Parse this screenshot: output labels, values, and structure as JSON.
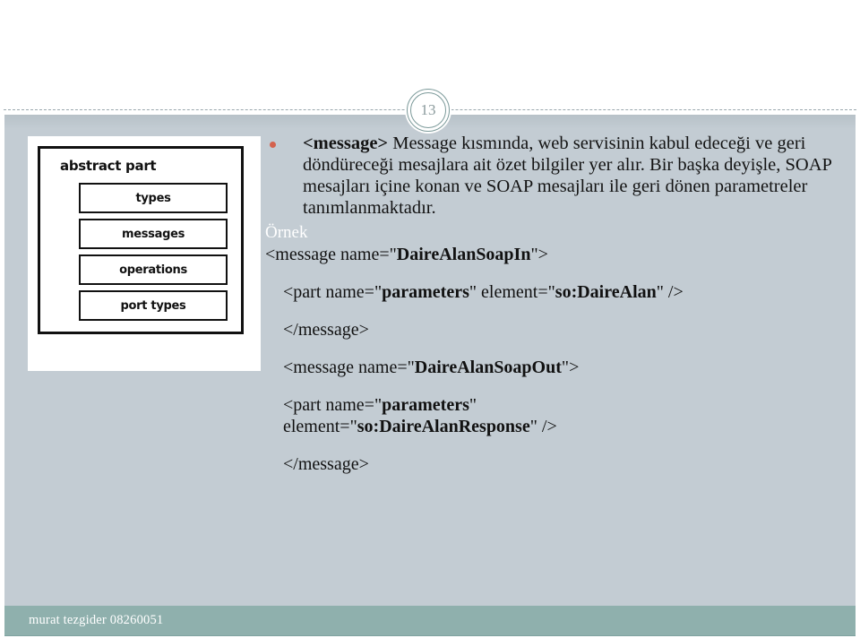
{
  "slide": {
    "number": "13",
    "colors": {
      "body_background": "#c3ccd3",
      "header_background": "#ffffff",
      "footer_background": "#8fb0ad",
      "bullet_accent": "#d4624e",
      "badge_ring": "#7c9a9a",
      "heading_white": "#ffffff",
      "code_text": "#111111"
    }
  },
  "figure": {
    "title": "abstract part",
    "boxes": [
      {
        "label": "types"
      },
      {
        "label": "messages"
      },
      {
        "label": "operations"
      },
      {
        "label": "port types"
      }
    ]
  },
  "content": {
    "bullet": {
      "tag": "<message>",
      "text": " Message kısmında, web servisinin kabul edeceği ve geri döndüreceği mesajlara ait özet bilgiler yer alır. Bir başka deyişle, SOAP mesajları içine konan ve SOAP mesajları ile geri dönen parametreler tanımlanmaktadır."
    },
    "example_label": "Örnek",
    "code_lines": [
      {
        "indent": 0,
        "segments": [
          {
            "text": "<message name=\"",
            "bold": false
          },
          {
            "text": "DaireAlanSoapIn",
            "bold": true
          },
          {
            "text": "\">",
            "bold": false
          }
        ]
      },
      {
        "indent": 1,
        "segments": [
          {
            "text": "<part name=\"",
            "bold": false
          },
          {
            "text": "parameters",
            "bold": true
          },
          {
            "text": "\" element=\"",
            "bold": false
          },
          {
            "text": "so:DaireAlan",
            "bold": true
          },
          {
            "text": "\" />",
            "bold": false
          }
        ]
      },
      {
        "indent": 1,
        "segments": [
          {
            "text": "</message>",
            "bold": false
          }
        ]
      },
      {
        "indent": 1,
        "segments": [
          {
            "text": "<message name=\"",
            "bold": false
          },
          {
            "text": "DaireAlanSoapOut",
            "bold": true
          },
          {
            "text": "\">",
            "bold": false
          }
        ]
      },
      {
        "indent": 1,
        "segments": [
          {
            "text": "<part name=\"",
            "bold": false
          },
          {
            "text": "parameters",
            "bold": true
          },
          {
            "text": "\"\n",
            "bold": false
          },
          {
            "text": "element=\"",
            "bold": false
          },
          {
            "text": "so:DaireAlanResponse",
            "bold": true
          },
          {
            "text": "\" />",
            "bold": false
          }
        ]
      },
      {
        "indent": 1,
        "segments": [
          {
            "text": "</message>",
            "bold": false
          }
        ]
      }
    ]
  },
  "footer": {
    "text": "murat tezgider 08260051"
  }
}
